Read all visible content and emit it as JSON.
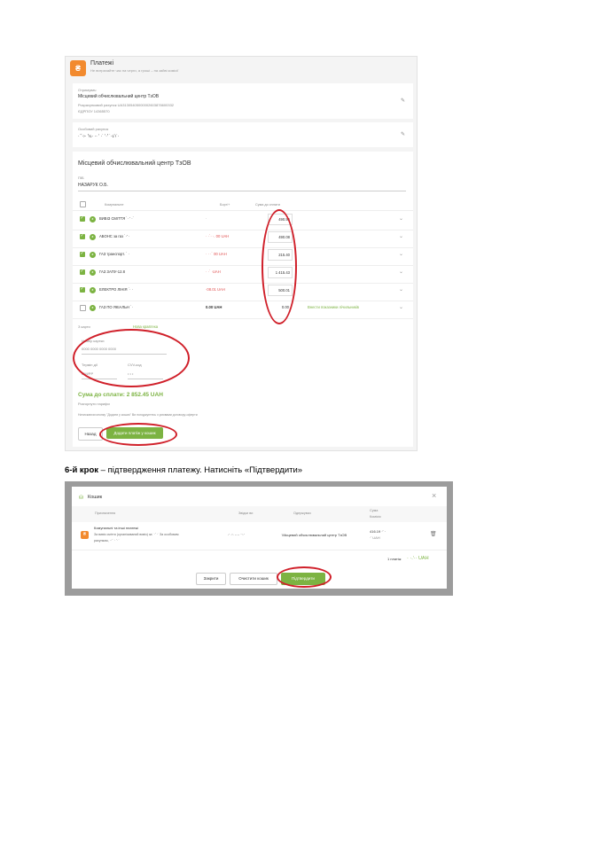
{
  "screen1": {
    "header": {
      "logo": "₴",
      "title": "Платежі",
      "subtitle": "Не витрачайте час на черги, а гроші – на зайві комісії"
    },
    "receiver": {
      "label": "Отримувач",
      "name": "Місцевий обчислювальний центр ТзОВ",
      "account": "Розрахунковий рахунок UA31305405000002603876600332",
      "edrpou": "ЄДРПОУ 14365570"
    },
    "personal_account": {
      "label": "Особовий рахунок",
      "value": "·˙ʻ·›· ꞌ›ʟ· ·· ʹ ·˙ ʹ·ꞌ ˙·ʟʹ‹˙·"
    },
    "section_title": "Місцевий обчислювальний центр ТзОВ",
    "pib": {
      "label": "ПІБ",
      "value": "НАЗАРУК О.Б."
    },
    "columns": {
      "name": "Комунальне",
      "debt": "Борг/+",
      "amount": "Сума до сплати"
    },
    "rows": [
      {
        "name": "ВИВІЗ СМІТТЯ  ˙· ʹ ·˙",
        "debt": "·",
        "amount": "490.56",
        "checked": true
      },
      {
        "name": "АБОНС за газ  ˙·ʹ  ·",
        "debt": "· ·˙·  ·. 00 UAH",
        "amount": "490.08",
        "checked": true
      },
      {
        "name": "ГАЗ транспорт.  ˙  ·",
        "debt": "·  · ·˙ 00 UAH",
        "amount": "215.40",
        "checked": true
      },
      {
        "name": "ГАЗ ЗАПУ-12.8",
        "debt": "·  ·˙ ·UAH",
        "amount": "1 415.43",
        "checked": true
      },
      {
        "name": "ЕЛЕКТРО ЛІНІЯ  ˙·  ·",
        "debt": "·08.01 UAH",
        "amount": "500.01",
        "checked": true
      },
      {
        "name": "ГАЗ ПО ЯКІАЛЬН  ˙·",
        "debt": "0.00 UAH",
        "amount": "0.00",
        "checked": false,
        "link": "Внести показники лічильників"
      }
    ],
    "card": {
      "label": "З карти",
      "new_card": "Нова кравтека",
      "number_label": "Номер картки",
      "number_placeholder": "0000 0000 0000 0000",
      "expiry_label": "Термін дії",
      "expiry_placeholder": "ММ/РР",
      "cvv_label": "CVV-код",
      "cvv_placeholder": "• • •"
    },
    "total": "Сума до сплати: 2 852.45 UAH",
    "tariffs": "Розгорнути тарифи",
    "agreement": "Натискаючи кнопку \"Додати у кошик\" Ви погоджуєтесь з умовами договору-оферти",
    "buttons": {
      "back": "Назад",
      "add": "Додати платіж у кошик"
    }
  },
  "caption": {
    "bold": "6-й крок",
    "text": " – підтвердження платежу. Натисніть «Підтвердити»"
  },
  "screen2": {
    "title": "Кошик",
    "close": "×",
    "columns": {
      "appointment": "Призначення",
      "from": "Звідки ви",
      "receiver": "Одержувач",
      "sum": "Сума",
      "commission": "Комісія"
    },
    "item": {
      "title": "Комунальні та інші платежі",
      "desc1": "За вивіз сміття (організований вивіз) за ˙·ʹ ·˙ За особовим",
      "desc2": "рахунком, ··ʹ ˙· ʹ·˙˙",
      "from": "·ʻ ·ʹ·  ····  ˙ʹ·ʻ",
      "receiver": "˙Місцевий обчислювальний  центр ТзОВ",
      "sum": "416.19 ·ʹ ·",
      "commission": "·ʹ UAH"
    },
    "total_label": "1 платіж",
    "total_value": "· ·.ʹ·· UAH",
    "buttons": {
      "close": "Закрити",
      "clear": "Очистити кошик",
      "confirm": "Підтвердити"
    }
  },
  "colors": {
    "accent_green": "#7cb342",
    "logo_orange": "#f28a2e",
    "highlight_red": "#d0202a"
  }
}
